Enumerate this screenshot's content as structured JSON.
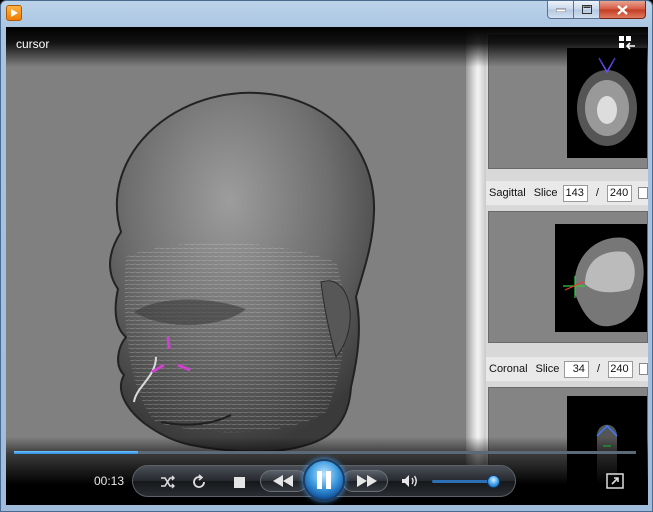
{
  "window": {
    "app_icon": "media-player-icon",
    "controls": [
      "minimize-icon",
      "maximize-icon",
      "close-icon"
    ]
  },
  "player": {
    "title": "cursor",
    "time_elapsed": "00:13",
    "seek_progress_percent": 20,
    "volume_percent": 96,
    "state": "playing",
    "buttons": [
      "shuffle-icon",
      "repeat-icon",
      "stop-icon",
      "previous-icon",
      "pause-icon",
      "next-icon",
      "volume-icon",
      "fullscreen-icon",
      "switch-to-library-icon"
    ]
  },
  "side_panel": {
    "sagittal": {
      "label": "Sagittal",
      "slice_label": "Slice",
      "slice_value": "143",
      "separator": "/",
      "slice_total": "240"
    },
    "coronal": {
      "label": "Coronal",
      "slice_label": "Slice",
      "slice_value": "34",
      "separator": "/",
      "slice_total": "240"
    }
  },
  "colors": {
    "accent": "#3d9be0",
    "viewport_bg": "#808080",
    "marker": "#d040d0"
  }
}
